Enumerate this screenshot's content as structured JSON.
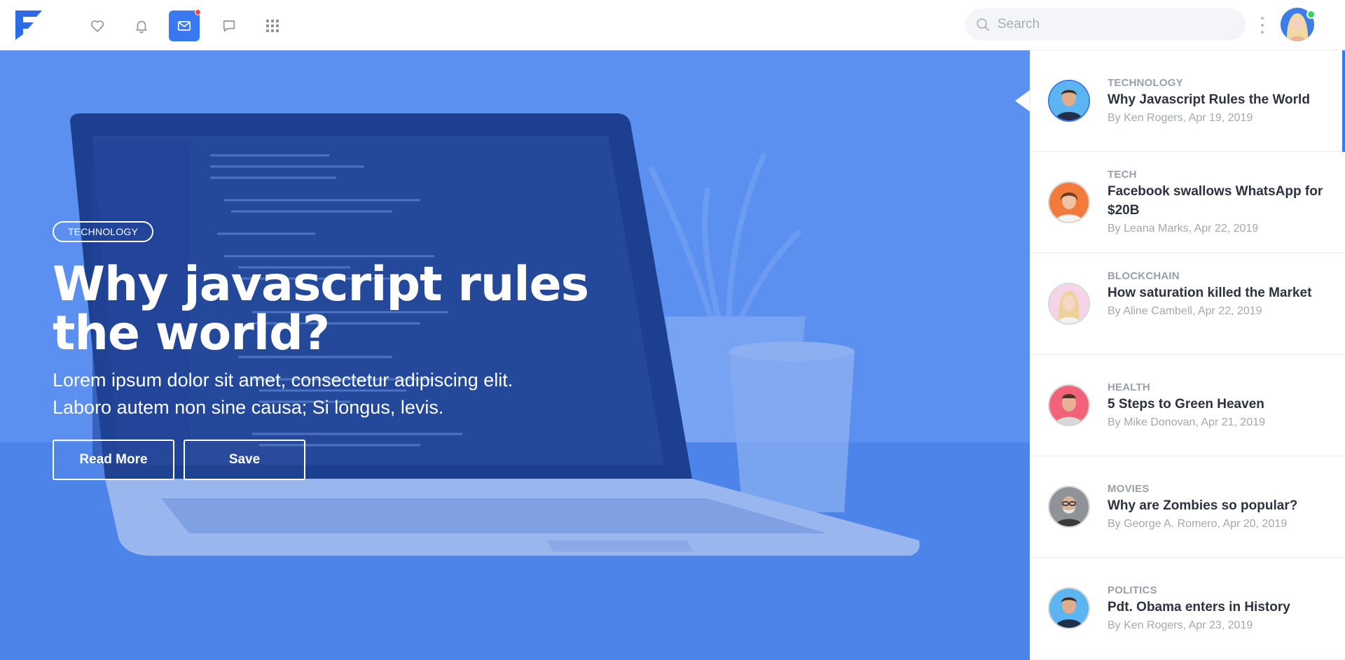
{
  "navbar": {
    "search_placeholder": "Search",
    "icons": [
      "heart-icon",
      "bell-icon",
      "mail-icon",
      "chat-icon",
      "apps-grid-icon"
    ],
    "active_icon": "mail-icon",
    "accent_color": "#3a78f2",
    "notification_dot_color": "#f04848",
    "online_status_color": "#2fd46a"
  },
  "hero": {
    "tag": "TECHNOLOGY",
    "title_line1": "Why javascript rules",
    "title_line2": "the world?",
    "subtitle_line1": "Lorem ipsum dolor sit amet, consectetur adipiscing elit.",
    "subtitle_line2": "Laboro autem non sine causa; Si longus, levis.",
    "read_more_label": "Read More",
    "save_label": "Save",
    "overlay_color": "#3a78f2"
  },
  "articles": [
    {
      "category": "TECHNOLOGY",
      "title": "Why Javascript Rules the World",
      "meta": "By Ken Rogers, Apr 19, 2019",
      "active": true
    },
    {
      "category": "TECH",
      "title": "Facebook swallows WhatsApp for $20B",
      "meta": "By Leana Marks, Apr 22, 2019",
      "active": false
    },
    {
      "category": "BLOCKCHAIN",
      "title": "How saturation killed the Market",
      "meta": "By Aline Cambell, Apr 22, 2019",
      "active": false
    },
    {
      "category": "HEALTH",
      "title": "5 Steps to Green Heaven",
      "meta": "By Mike Donovan, Apr 21, 2019",
      "active": false
    },
    {
      "category": "MOVIES",
      "title": "Why are Zombies so popular?",
      "meta": "By George A. Romero, Apr 20, 2019",
      "active": false
    },
    {
      "category": "POLITICS",
      "title": "Pdt. Obama enters in History",
      "meta": "By Ken Rogers, Apr 23, 2019",
      "active": false
    }
  ]
}
